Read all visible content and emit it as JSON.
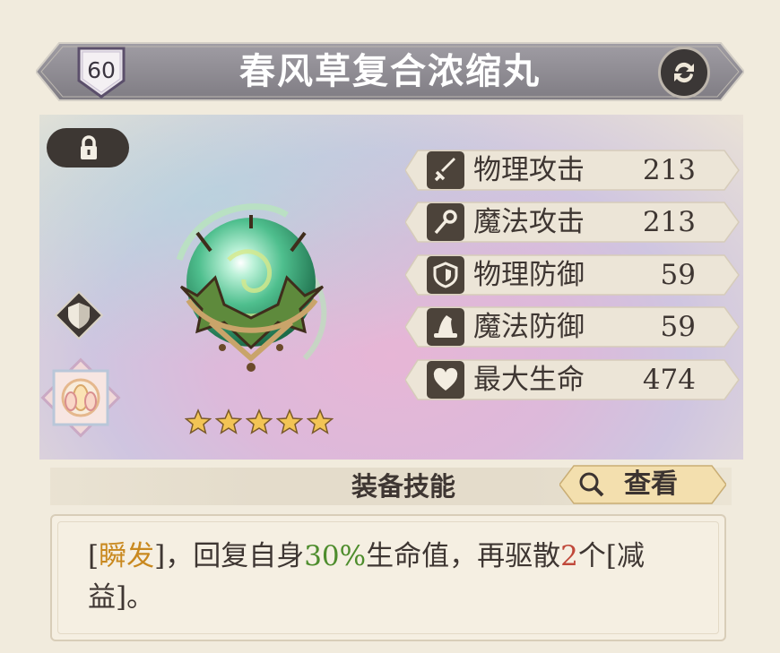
{
  "item": {
    "level": "60",
    "name": "春风草复合浓缩丸",
    "rarity_stars": 5
  },
  "stats": [
    {
      "icon": "sword-icon",
      "label": "物理攻击",
      "value": "213"
    },
    {
      "icon": "staff-icon",
      "label": "魔法攻击",
      "value": "213"
    },
    {
      "icon": "shield-icon",
      "label": "物理防御",
      "value": "59"
    },
    {
      "icon": "wizard-hat-icon",
      "label": "魔法防御",
      "value": "59"
    },
    {
      "icon": "heart-icon",
      "label": "最大生命",
      "value": "474"
    }
  ],
  "skill": {
    "section_title": "装备技能",
    "view_label": "查看",
    "desc_open": "[",
    "desc_tag": "瞬发",
    "desc_part1": "]，回复自身",
    "desc_percent": "30%",
    "desc_part2": "生命值，再驱散",
    "desc_count": "2",
    "desc_part3": "个[减益]。"
  },
  "colors": {
    "accent_orange": "#c9891f",
    "accent_green": "#4e8d2d",
    "accent_red": "#c0483a",
    "header_bg": "#8d8a90"
  }
}
